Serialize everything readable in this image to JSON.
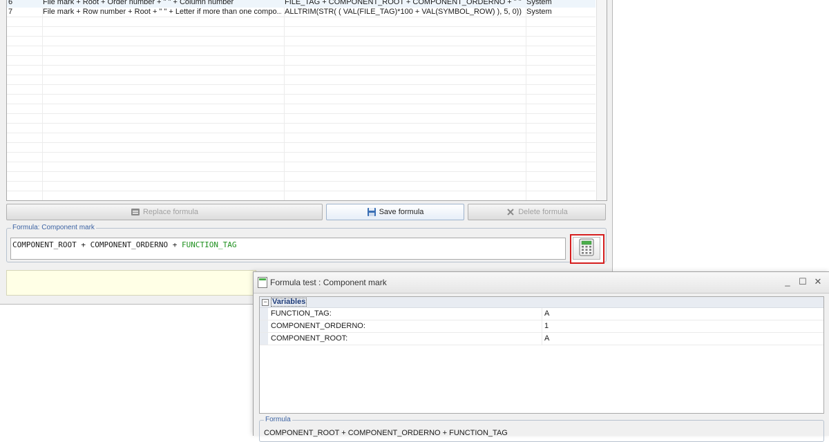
{
  "grid": {
    "rows": [
      {
        "num": "6",
        "description": "File mark + Root + Order number + \" \" + Column number",
        "formula": "FILE_TAG + COMPONENT_ROOT + COMPONENT_ORDERNO + \" \" + S...",
        "type": "System"
      },
      {
        "num": "7",
        "description": "File mark + Row number + Root + \" \" + Letter if more than one compo...",
        "formula": "ALLTRIM(STR( ( VAL(FILE_TAG)*100 + VAL(SYMBOL_ROW) ), 5, 0)) ...",
        "type": "System"
      }
    ]
  },
  "buttons": {
    "replace": "Replace formula",
    "save": "Save formula",
    "delete": "Delete formula"
  },
  "formula": {
    "group_label": "Formula: Component mark",
    "part1": "COMPONENT_ROOT + COMPONENT_ORDERNO + ",
    "part2": "FUNCTION_TAG"
  },
  "dialog": {
    "title": "Formula test : Component mark",
    "minimize": "_",
    "maximize": "☐",
    "close": "✕",
    "variables_label": "Variables",
    "collapse": "−",
    "variables": [
      {
        "name": "FUNCTION_TAG:",
        "value": "A"
      },
      {
        "name": "COMPONENT_ORDERNO:",
        "value": "1"
      },
      {
        "name": "COMPONENT_ROOT:",
        "value": "A"
      }
    ],
    "formula_label": "Formula",
    "formula_text": "COMPONENT_ROOT + COMPONENT_ORDERNO + FUNCTION_TAG"
  },
  "colors": {
    "highlight_border": "#d51d1d",
    "function_token": "#1c8f1c",
    "group_label": "#3c63a3"
  }
}
